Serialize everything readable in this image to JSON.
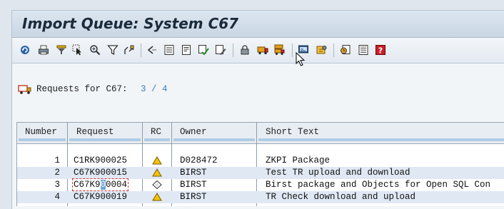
{
  "window": {
    "title": "Import Queue: System C67"
  },
  "toolbar": {
    "icons": [
      "refresh-icon",
      "print-icon",
      "filter-icon",
      "select-icon",
      "zoom-icon",
      "funnel-icon",
      "expand-icon",
      "back-icon",
      "list-icon",
      "doc-icon",
      "check-icon",
      "edit-icon",
      "lock-icon",
      "truck-icon",
      "truck-list-icon",
      "display-icon",
      "settings-icon",
      "monitor-icon",
      "log-icon",
      "help-icon"
    ]
  },
  "summary": {
    "label": "Requests for C67:",
    "count": "3 / 4"
  },
  "table": {
    "columns": [
      "Number",
      "Request",
      "RC",
      "Owner",
      "Short Text"
    ],
    "rows": [
      {
        "number": "1",
        "request": "C1RK900025",
        "rc": "warning",
        "owner": "D028472",
        "text": "ZKPI Package"
      },
      {
        "number": "2",
        "request": "C67K900015",
        "rc": "warning",
        "owner": "BIRST",
        "text": "Test TR upload and download"
      },
      {
        "number": "3",
        "request_a": "C67K9",
        "request_b": "0",
        "request_c": "0004",
        "rc": "diamond",
        "owner": "BIRST",
        "text": "Birst package and Objects for Open SQL Con"
      },
      {
        "number": "4",
        "request": "C67K900019",
        "rc": "warning",
        "owner": "BIRST",
        "text": "TR Check download and upload"
      }
    ]
  },
  "colors": {
    "accent_blue": "#3c7cb6",
    "row_alt": "#dfe8f3",
    "warning_yellow": "#f2c500"
  }
}
